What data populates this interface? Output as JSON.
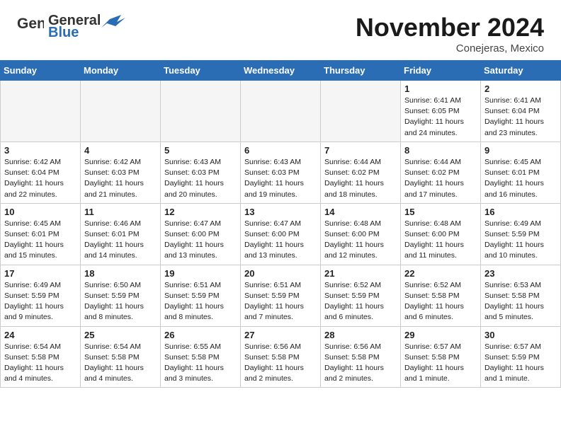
{
  "header": {
    "logo_general": "General",
    "logo_blue": "Blue",
    "month_title": "November 2024",
    "location": "Conejeras, Mexico"
  },
  "weekdays": [
    "Sunday",
    "Monday",
    "Tuesday",
    "Wednesday",
    "Thursday",
    "Friday",
    "Saturday"
  ],
  "weeks": [
    [
      {
        "day": "",
        "sunrise": "",
        "sunset": "",
        "daylight": ""
      },
      {
        "day": "",
        "sunrise": "",
        "sunset": "",
        "daylight": ""
      },
      {
        "day": "",
        "sunrise": "",
        "sunset": "",
        "daylight": ""
      },
      {
        "day": "",
        "sunrise": "",
        "sunset": "",
        "daylight": ""
      },
      {
        "day": "",
        "sunrise": "",
        "sunset": "",
        "daylight": ""
      },
      {
        "day": "1",
        "sunrise": "Sunrise: 6:41 AM",
        "sunset": "Sunset: 6:05 PM",
        "daylight": "Daylight: 11 hours and 24 minutes."
      },
      {
        "day": "2",
        "sunrise": "Sunrise: 6:41 AM",
        "sunset": "Sunset: 6:04 PM",
        "daylight": "Daylight: 11 hours and 23 minutes."
      }
    ],
    [
      {
        "day": "3",
        "sunrise": "Sunrise: 6:42 AM",
        "sunset": "Sunset: 6:04 PM",
        "daylight": "Daylight: 11 hours and 22 minutes."
      },
      {
        "day": "4",
        "sunrise": "Sunrise: 6:42 AM",
        "sunset": "Sunset: 6:03 PM",
        "daylight": "Daylight: 11 hours and 21 minutes."
      },
      {
        "day": "5",
        "sunrise": "Sunrise: 6:43 AM",
        "sunset": "Sunset: 6:03 PM",
        "daylight": "Daylight: 11 hours and 20 minutes."
      },
      {
        "day": "6",
        "sunrise": "Sunrise: 6:43 AM",
        "sunset": "Sunset: 6:03 PM",
        "daylight": "Daylight: 11 hours and 19 minutes."
      },
      {
        "day": "7",
        "sunrise": "Sunrise: 6:44 AM",
        "sunset": "Sunset: 6:02 PM",
        "daylight": "Daylight: 11 hours and 18 minutes."
      },
      {
        "day": "8",
        "sunrise": "Sunrise: 6:44 AM",
        "sunset": "Sunset: 6:02 PM",
        "daylight": "Daylight: 11 hours and 17 minutes."
      },
      {
        "day": "9",
        "sunrise": "Sunrise: 6:45 AM",
        "sunset": "Sunset: 6:01 PM",
        "daylight": "Daylight: 11 hours and 16 minutes."
      }
    ],
    [
      {
        "day": "10",
        "sunrise": "Sunrise: 6:45 AM",
        "sunset": "Sunset: 6:01 PM",
        "daylight": "Daylight: 11 hours and 15 minutes."
      },
      {
        "day": "11",
        "sunrise": "Sunrise: 6:46 AM",
        "sunset": "Sunset: 6:01 PM",
        "daylight": "Daylight: 11 hours and 14 minutes."
      },
      {
        "day": "12",
        "sunrise": "Sunrise: 6:47 AM",
        "sunset": "Sunset: 6:00 PM",
        "daylight": "Daylight: 11 hours and 13 minutes."
      },
      {
        "day": "13",
        "sunrise": "Sunrise: 6:47 AM",
        "sunset": "Sunset: 6:00 PM",
        "daylight": "Daylight: 11 hours and 13 minutes."
      },
      {
        "day": "14",
        "sunrise": "Sunrise: 6:48 AM",
        "sunset": "Sunset: 6:00 PM",
        "daylight": "Daylight: 11 hours and 12 minutes."
      },
      {
        "day": "15",
        "sunrise": "Sunrise: 6:48 AM",
        "sunset": "Sunset: 6:00 PM",
        "daylight": "Daylight: 11 hours and 11 minutes."
      },
      {
        "day": "16",
        "sunrise": "Sunrise: 6:49 AM",
        "sunset": "Sunset: 5:59 PM",
        "daylight": "Daylight: 11 hours and 10 minutes."
      }
    ],
    [
      {
        "day": "17",
        "sunrise": "Sunrise: 6:49 AM",
        "sunset": "Sunset: 5:59 PM",
        "daylight": "Daylight: 11 hours and 9 minutes."
      },
      {
        "day": "18",
        "sunrise": "Sunrise: 6:50 AM",
        "sunset": "Sunset: 5:59 PM",
        "daylight": "Daylight: 11 hours and 8 minutes."
      },
      {
        "day": "19",
        "sunrise": "Sunrise: 6:51 AM",
        "sunset": "Sunset: 5:59 PM",
        "daylight": "Daylight: 11 hours and 8 minutes."
      },
      {
        "day": "20",
        "sunrise": "Sunrise: 6:51 AM",
        "sunset": "Sunset: 5:59 PM",
        "daylight": "Daylight: 11 hours and 7 minutes."
      },
      {
        "day": "21",
        "sunrise": "Sunrise: 6:52 AM",
        "sunset": "Sunset: 5:59 PM",
        "daylight": "Daylight: 11 hours and 6 minutes."
      },
      {
        "day": "22",
        "sunrise": "Sunrise: 6:52 AM",
        "sunset": "Sunset: 5:58 PM",
        "daylight": "Daylight: 11 hours and 6 minutes."
      },
      {
        "day": "23",
        "sunrise": "Sunrise: 6:53 AM",
        "sunset": "Sunset: 5:58 PM",
        "daylight": "Daylight: 11 hours and 5 minutes."
      }
    ],
    [
      {
        "day": "24",
        "sunrise": "Sunrise: 6:54 AM",
        "sunset": "Sunset: 5:58 PM",
        "daylight": "Daylight: 11 hours and 4 minutes."
      },
      {
        "day": "25",
        "sunrise": "Sunrise: 6:54 AM",
        "sunset": "Sunset: 5:58 PM",
        "daylight": "Daylight: 11 hours and 4 minutes."
      },
      {
        "day": "26",
        "sunrise": "Sunrise: 6:55 AM",
        "sunset": "Sunset: 5:58 PM",
        "daylight": "Daylight: 11 hours and 3 minutes."
      },
      {
        "day": "27",
        "sunrise": "Sunrise: 6:56 AM",
        "sunset": "Sunset: 5:58 PM",
        "daylight": "Daylight: 11 hours and 2 minutes."
      },
      {
        "day": "28",
        "sunrise": "Sunrise: 6:56 AM",
        "sunset": "Sunset: 5:58 PM",
        "daylight": "Daylight: 11 hours and 2 minutes."
      },
      {
        "day": "29",
        "sunrise": "Sunrise: 6:57 AM",
        "sunset": "Sunset: 5:58 PM",
        "daylight": "Daylight: 11 hours and 1 minute."
      },
      {
        "day": "30",
        "sunrise": "Sunrise: 6:57 AM",
        "sunset": "Sunset: 5:59 PM",
        "daylight": "Daylight: 11 hours and 1 minute."
      }
    ]
  ]
}
